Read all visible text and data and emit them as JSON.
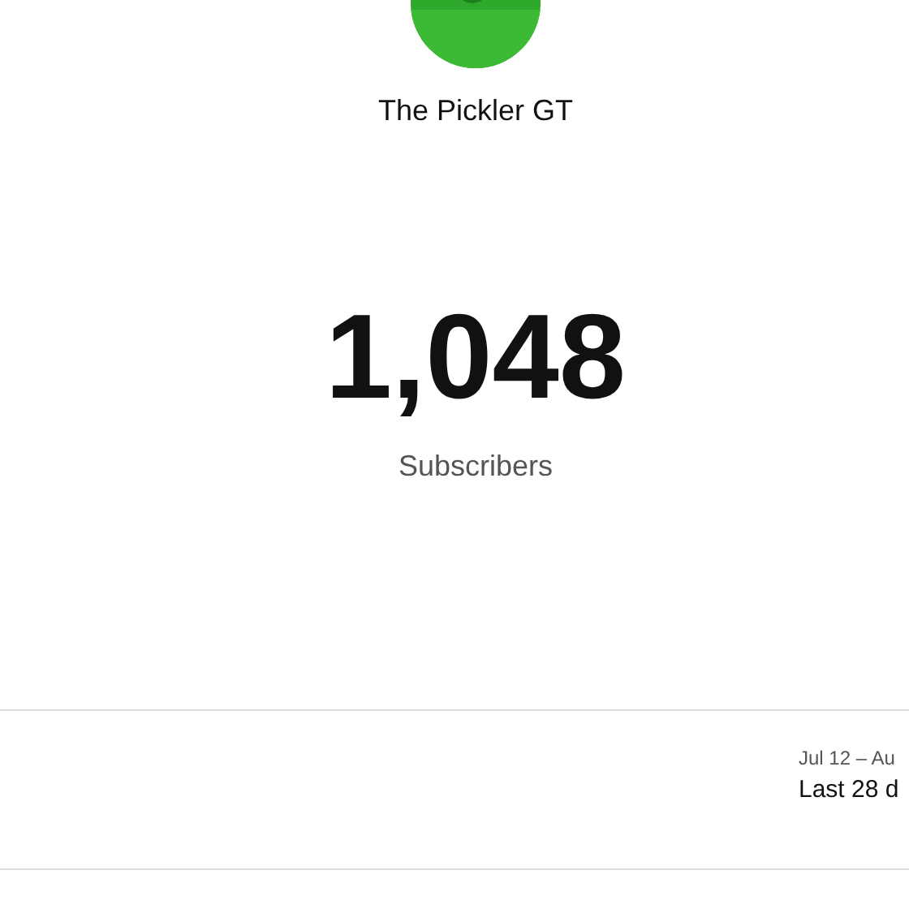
{
  "channel": {
    "name": "The Pickler GT"
  },
  "stat": {
    "value": "1,048",
    "label": "Subscribers"
  },
  "period": {
    "dates": "Jul 12 – Au",
    "label": "Last 28 d"
  }
}
